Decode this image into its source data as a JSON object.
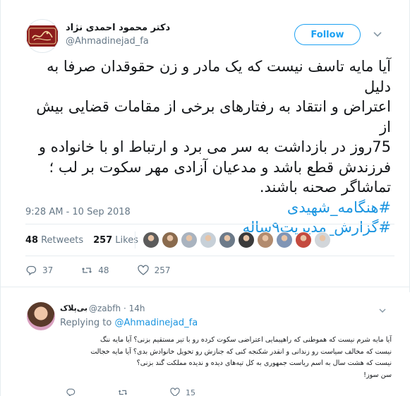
{
  "author": {
    "name": "دکتر محمود احمدی نژاد",
    "handle": "@Ahmadinejad_fa",
    "avatar_icon": "seal-logo-icon",
    "avatar_logo_text": "محمود احمدی نژاد"
  },
  "follow_label": "Follow",
  "tweet": {
    "lines": [
      "آیا مایه تاسف نیست که یک مادر و زن حقوقدان صرفا به دلیل",
      "اعتراض و انتقاد به رفتارهای برخی از مقامات قضایی بیش از",
      "75روز در بازداشت به سر می برد و ارتباط او با خانواده و",
      "فرزندش قطع باشد و مدعیان آزادی مهر سکوت بر لب ؛",
      "تماشاگر صحنه باشند."
    ],
    "hashtags": [
      "#هنگامه_شهیدی",
      "#گزارش_مدیریت۹ساله"
    ],
    "timestamp": "9:28 AM - 10 Sep 2018"
  },
  "stats": {
    "retweets_count": "48",
    "retweets_label": "Retweets",
    "likes_count": "257",
    "likes_label": "Likes"
  },
  "actions": {
    "reply_count": "37",
    "retweet_count": "48",
    "like_count": "257"
  },
  "reply": {
    "name": "بی‌پلاک",
    "handle": "@zabfh",
    "time": "· 14h",
    "replying_prefix": "Replying to",
    "replying_to": "@Ahmadinejad_fa",
    "lines": [
      "آیا مایه شرم نیست که هموطنی که راهپیمایی اعتراضی سکوت کرده رو با تیر مستقیم بزنی؟ آیا مایه ننگ",
      "نیست که مخالف سیاست رو زندانی و انقدر شکنجه کنی که جنازش رو تحویل خانوادش بدی؟ آیا مایه خجالت",
      "نیست که هشت سال به اسم ریاست جمهوری به کل تیه‌های دیده و ندیده مملکت گند بزنی؟",
      "سن سوز!"
    ],
    "like_count": "15"
  },
  "colors": {
    "accent": "#1da1f2",
    "link": "#1b95e0",
    "muted": "#657786",
    "text": "#14171a",
    "like_heart": "#657786"
  },
  "faces": [
    {
      "icon": "liker-avatar-icon",
      "color": "#5b5b5b"
    },
    {
      "icon": "liker-avatar-icon",
      "color": "#8a6b4e"
    },
    {
      "icon": "liker-avatar-icon",
      "color": "#a9b3bf"
    },
    {
      "icon": "liker-avatar-icon",
      "color": "#c7d0d8"
    },
    {
      "icon": "liker-avatar-icon",
      "color": "#6c7a89"
    },
    {
      "icon": "liker-avatar-icon",
      "color": "#3b3b3b"
    },
    {
      "icon": "liker-avatar-icon",
      "color": "#b28b6e"
    },
    {
      "icon": "liker-avatar-icon",
      "color": "#8095b5"
    },
    {
      "icon": "liker-avatar-icon",
      "color": "#c44a3f"
    },
    {
      "icon": "liker-avatar-icon",
      "color": "#d2d6da"
    }
  ]
}
